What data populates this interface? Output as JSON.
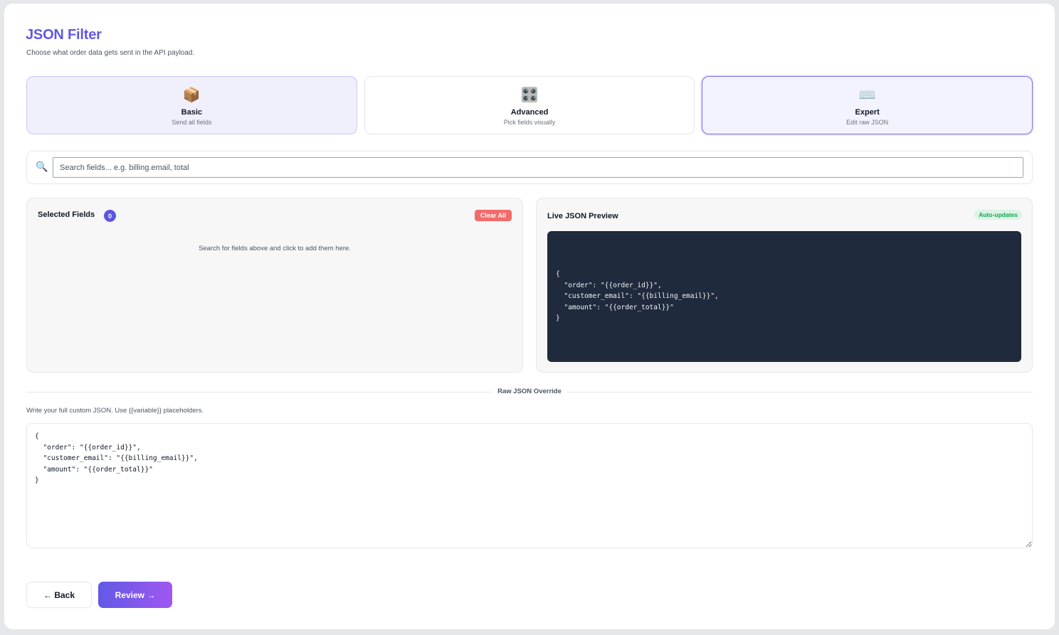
{
  "header": {
    "title": "JSON Filter",
    "subtitle": "Choose what order data gets sent in the API payload."
  },
  "modes": [
    {
      "icon": "package-icon",
      "glyph": "📦",
      "label": "Basic",
      "description": "Send all fields"
    },
    {
      "icon": "grid-icon",
      "glyph": "🎛️",
      "label": "Advanced",
      "description": "Pick fields visually"
    },
    {
      "icon": "keyboard-icon",
      "glyph": "⌨️",
      "label": "Expert",
      "description": "Edit raw JSON"
    }
  ],
  "selected_mode": "Expert",
  "search": {
    "icon": "search-icon",
    "placeholder": "Search fields... e.g. billing.email, total",
    "value": ""
  },
  "selected_fields": {
    "title": "Selected Fields",
    "count": "0",
    "clear_label": "Clear All",
    "empty_message": "Search for fields above and click to add them here."
  },
  "preview": {
    "title": "Live JSON Preview",
    "badge": "Auto-updates",
    "code": "{\n  \"order\": \"{{order_id}}\",\n  \"customer_email\": \"{{billing_email}}\",\n  \"amount\": \"{{order_total}}\"\n}"
  },
  "raw_override": {
    "section_label": "Raw JSON Override",
    "help": "Write your full custom JSON. Use {{variable}} placeholders.",
    "value": "{\n  \"order\": \"{{order_id}}\",\n  \"customer_email\": \"{{billing_email}}\",\n  \"amount\": \"{{order_total}}\"\n}"
  },
  "footer": {
    "back_label": "← Back",
    "review_label": "Review →"
  },
  "colors": {
    "accent": "#6257e3",
    "danger": "#f26b6b",
    "success": "#16a34a",
    "code_bg": "#1f2a3d"
  }
}
